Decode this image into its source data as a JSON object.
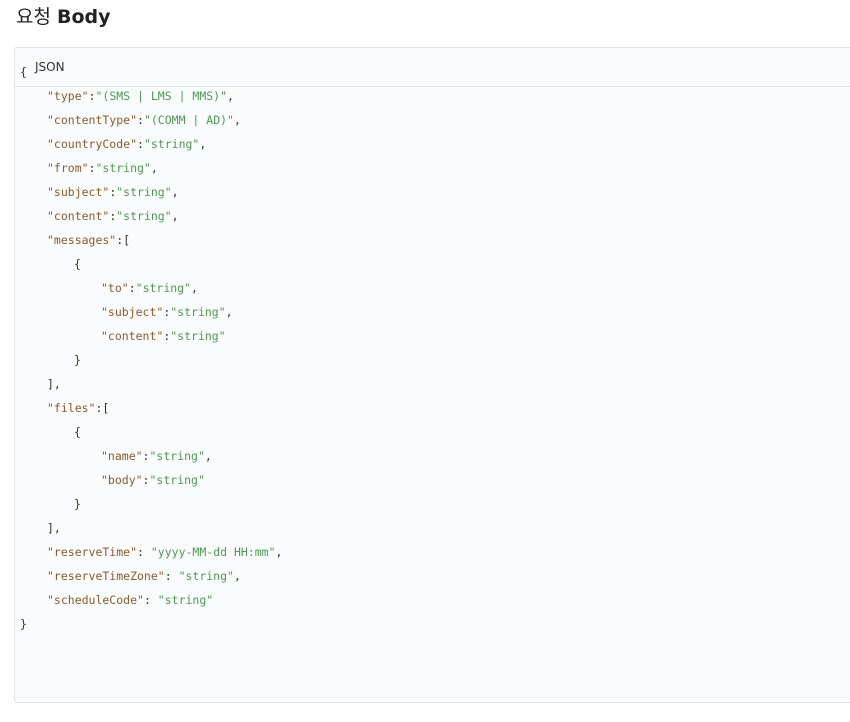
{
  "title": {
    "prefix": "요청",
    "bold": "Body"
  },
  "panel": {
    "language_label": "JSON"
  },
  "code": {
    "open_brace": "{",
    "close_brace": "}",
    "fields": [
      {
        "key": "\"type\"",
        "sep": ":",
        "value": "\"(SMS | LMS | MMS)\"",
        "trail": ","
      },
      {
        "key": "\"contentType\"",
        "sep": ":",
        "value": "\"(COMM | AD)\"",
        "trail": ","
      },
      {
        "key": "\"countryCode\"",
        "sep": ":",
        "value": "\"string\"",
        "trail": ","
      },
      {
        "key": "\"from\"",
        "sep": ":",
        "value": "\"string\"",
        "trail": ","
      },
      {
        "key": "\"subject\"",
        "sep": ":",
        "value": "\"string\"",
        "trail": ","
      },
      {
        "key": "\"content\"",
        "sep": ":",
        "value": "\"string\"",
        "trail": ","
      }
    ],
    "messages": {
      "key": "\"messages\"",
      "open": ":[",
      "item_open": "{",
      "item_close": "}",
      "close": "],",
      "fields": [
        {
          "key": "\"to\"",
          "sep": ":",
          "value": "\"string\"",
          "trail": ","
        },
        {
          "key": "\"subject\"",
          "sep": ":",
          "value": "\"string\"",
          "trail": ","
        },
        {
          "key": "\"content\"",
          "sep": ":",
          "value": "\"string\"",
          "trail": ""
        }
      ]
    },
    "files": {
      "key": "\"files\"",
      "open": ":[",
      "item_open": "{",
      "item_close": "}",
      "close": "],",
      "fields": [
        {
          "key": "\"name\"",
          "sep": ":",
          "value": "\"string\"",
          "trail": ","
        },
        {
          "key": "\"body\"",
          "sep": ":",
          "value": "\"string\"",
          "trail": ""
        }
      ]
    },
    "tail_fields": [
      {
        "key": "\"reserveTime\"",
        "sep": ": ",
        "value": "\"yyyy-MM-dd HH:mm\"",
        "trail": ","
      },
      {
        "key": "\"reserveTimeZone\"",
        "sep": ": ",
        "value": "\"string\"",
        "trail": ","
      },
      {
        "key": "\"scheduleCode\"",
        "sep": ": ",
        "value": "\"string\"",
        "trail": ""
      }
    ]
  },
  "colors": {
    "key": "#8a5a2b",
    "string": "#4e9a52",
    "punct": "#333333",
    "panel_bg": "#fafbfc",
    "border": "#e1e4e8"
  }
}
